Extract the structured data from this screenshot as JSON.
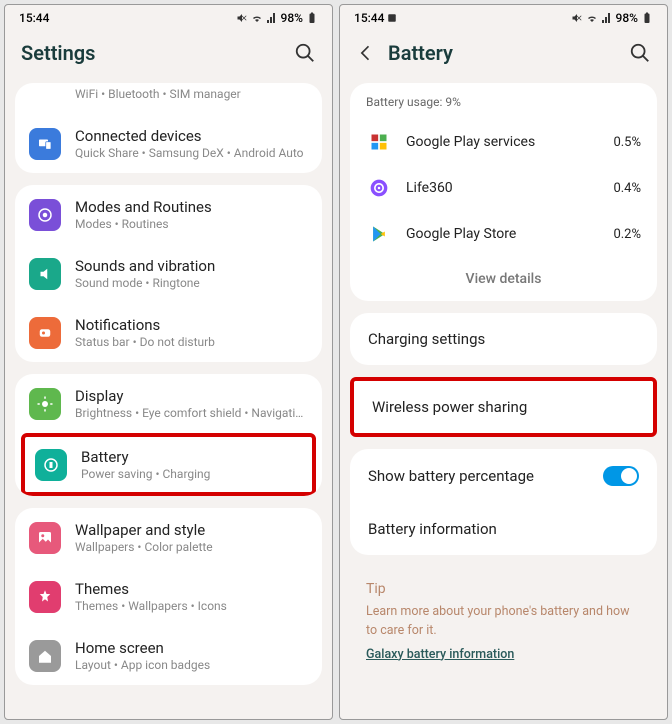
{
  "status": {
    "time": "15:44",
    "battery": "98%"
  },
  "left": {
    "title": "Settings",
    "groups": [
      {
        "truncated_sub": "WiFi  •  Bluetooth  •  SIM manager",
        "items": [
          {
            "icon": "devices",
            "bg": "bg-blue",
            "title": "Connected devices",
            "sub": "Quick Share  •  Samsung DeX  •  Android Auto"
          }
        ]
      },
      {
        "items": [
          {
            "icon": "modes",
            "bg": "bg-purple",
            "title": "Modes and Routines",
            "sub": "Modes  •  Routines"
          },
          {
            "icon": "sound",
            "bg": "bg-teal",
            "title": "Sounds and vibration",
            "sub": "Sound mode  •  Ringtone"
          },
          {
            "icon": "notif",
            "bg": "bg-orange",
            "title": "Notifications",
            "sub": "Status bar  •  Do not disturb"
          }
        ]
      },
      {
        "items": [
          {
            "icon": "display",
            "bg": "bg-green",
            "title": "Display",
            "sub": "Brightness  •  Eye comfort shield  •  Navigation bar"
          },
          {
            "icon": "battery",
            "bg": "bg-batt",
            "title": "Battery",
            "sub": "Power saving  •  Charging",
            "highlight": true
          }
        ]
      },
      {
        "items": [
          {
            "icon": "wallpaper",
            "bg": "bg-pink",
            "title": "Wallpaper and style",
            "sub": "Wallpapers  •  Color palette"
          },
          {
            "icon": "themes",
            "bg": "bg-pink2",
            "title": "Themes",
            "sub": "Themes  •  Wallpapers  •  Icons"
          },
          {
            "icon": "home",
            "bg": "bg-gray",
            "title": "Home screen",
            "sub": "Layout  •  App icon badges"
          }
        ]
      }
    ]
  },
  "right": {
    "title": "Battery",
    "usage_label": "Battery usage: 9%",
    "usage": [
      {
        "name": "Google Play services",
        "val": "0.5%",
        "icon": "play-services"
      },
      {
        "name": "Life360",
        "val": "0.4%",
        "icon": "life360"
      },
      {
        "name": "Google Play Store",
        "val": "0.2%",
        "icon": "play-store"
      }
    ],
    "view_details": "View details",
    "rows": {
      "charging": "Charging settings",
      "wireless": "Wireless power sharing",
      "percentage": "Show battery percentage",
      "info": "Battery information"
    },
    "tip": {
      "title": "Tip",
      "text": "Learn more about your phone's battery and how to care for it.",
      "link": "Galaxy battery information"
    }
  }
}
